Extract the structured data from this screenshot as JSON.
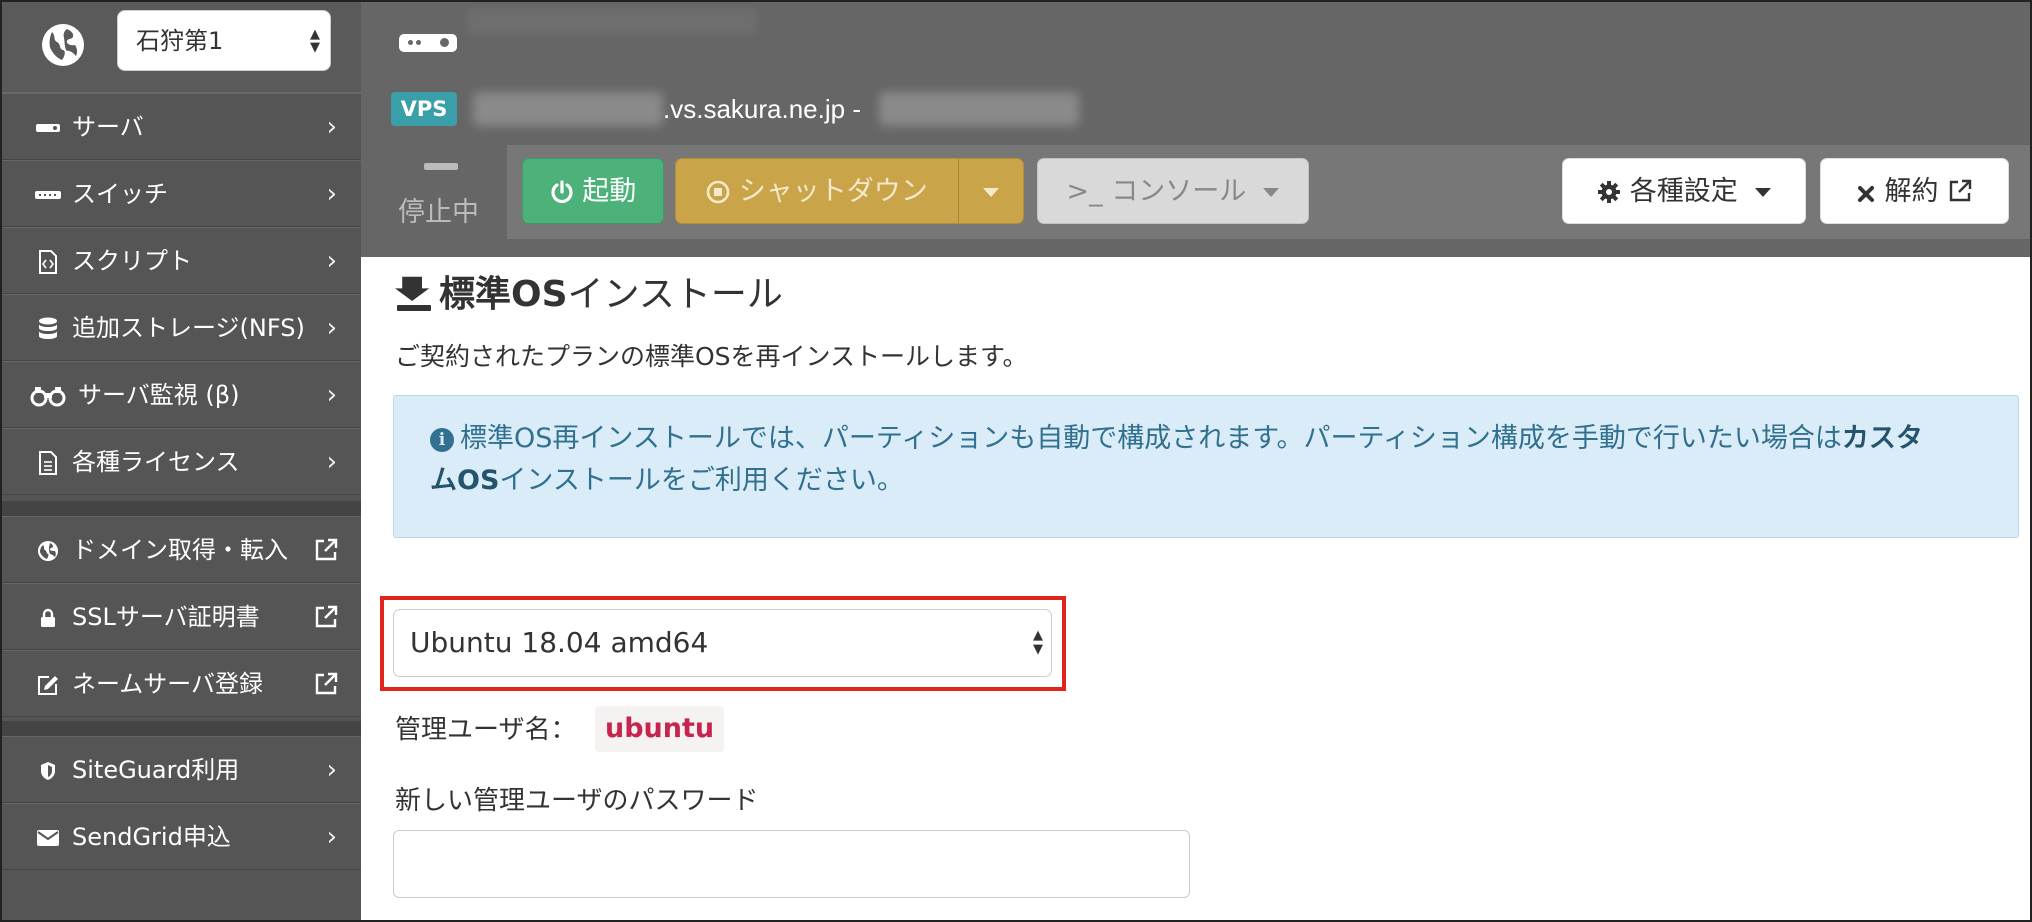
{
  "sidebar": {
    "region_select": {
      "value": "石狩第1"
    },
    "items_group1": [
      {
        "label": "サーバ",
        "icon": "server-icon"
      },
      {
        "label": "スイッチ",
        "icon": "switch-icon"
      },
      {
        "label": "スクリプト",
        "icon": "script-file-icon"
      },
      {
        "label": "追加ストレージ(NFS)",
        "icon": "database-icon"
      },
      {
        "label": "サーバ監視 (β)",
        "icon": "binoculars-icon"
      },
      {
        "label": "各種ライセンス",
        "icon": "document-icon"
      }
    ],
    "items_group2": [
      {
        "label": "ドメイン取得・転入",
        "icon": "globe-icon",
        "external": true
      },
      {
        "label": "SSLサーバ証明書",
        "icon": "lock-icon",
        "external": true
      },
      {
        "label": "ネームサーバ登録",
        "icon": "edit-icon",
        "external": true
      }
    ],
    "items_group3": [
      {
        "label": "SiteGuard利用",
        "icon": "shield-icon"
      },
      {
        "label": "SendGrid申込",
        "icon": "envelope-icon"
      }
    ]
  },
  "header": {
    "badge": "VPS",
    "hostname_visible": ".vs.sakura.ne.jp -",
    "status": "停止中",
    "buttons": {
      "start": "起動",
      "shutdown": "シャットダウン",
      "console": ">_ コンソール",
      "settings": "各種設定",
      "cancel": "解約"
    }
  },
  "main": {
    "title_bold": "標準OS",
    "title_rest": "インストール",
    "description": "ご契約されたプランの標準OSを再インストールします。",
    "info": {
      "text_prefix": "標準OS再インストールでは、パーティションも自動で構成されます。パーティション構成を手動で行いたい場合は",
      "link_line1": "カスタ",
      "link_line2_a": "ム",
      "link_line2_b": "OS",
      "link_line2_c": "インストール",
      "text_suffix": "をご利用ください。"
    },
    "os_select": {
      "value": "Ubuntu 18.04 amd64"
    },
    "admin_user_label": "管理ユーザ名：",
    "admin_user_value": "ubuntu",
    "password_label": "新しい管理ユーザのパスワード",
    "password_value": ""
  },
  "colors": {
    "sidebar_bg": "#555555",
    "header_bg": "#666666",
    "start_button": "#4cb27a",
    "shutdown_button": "#c9a449",
    "vps_badge": "#3a9fa8",
    "info_bg": "#d9ecf7",
    "highlight_outline": "#e0261c"
  }
}
